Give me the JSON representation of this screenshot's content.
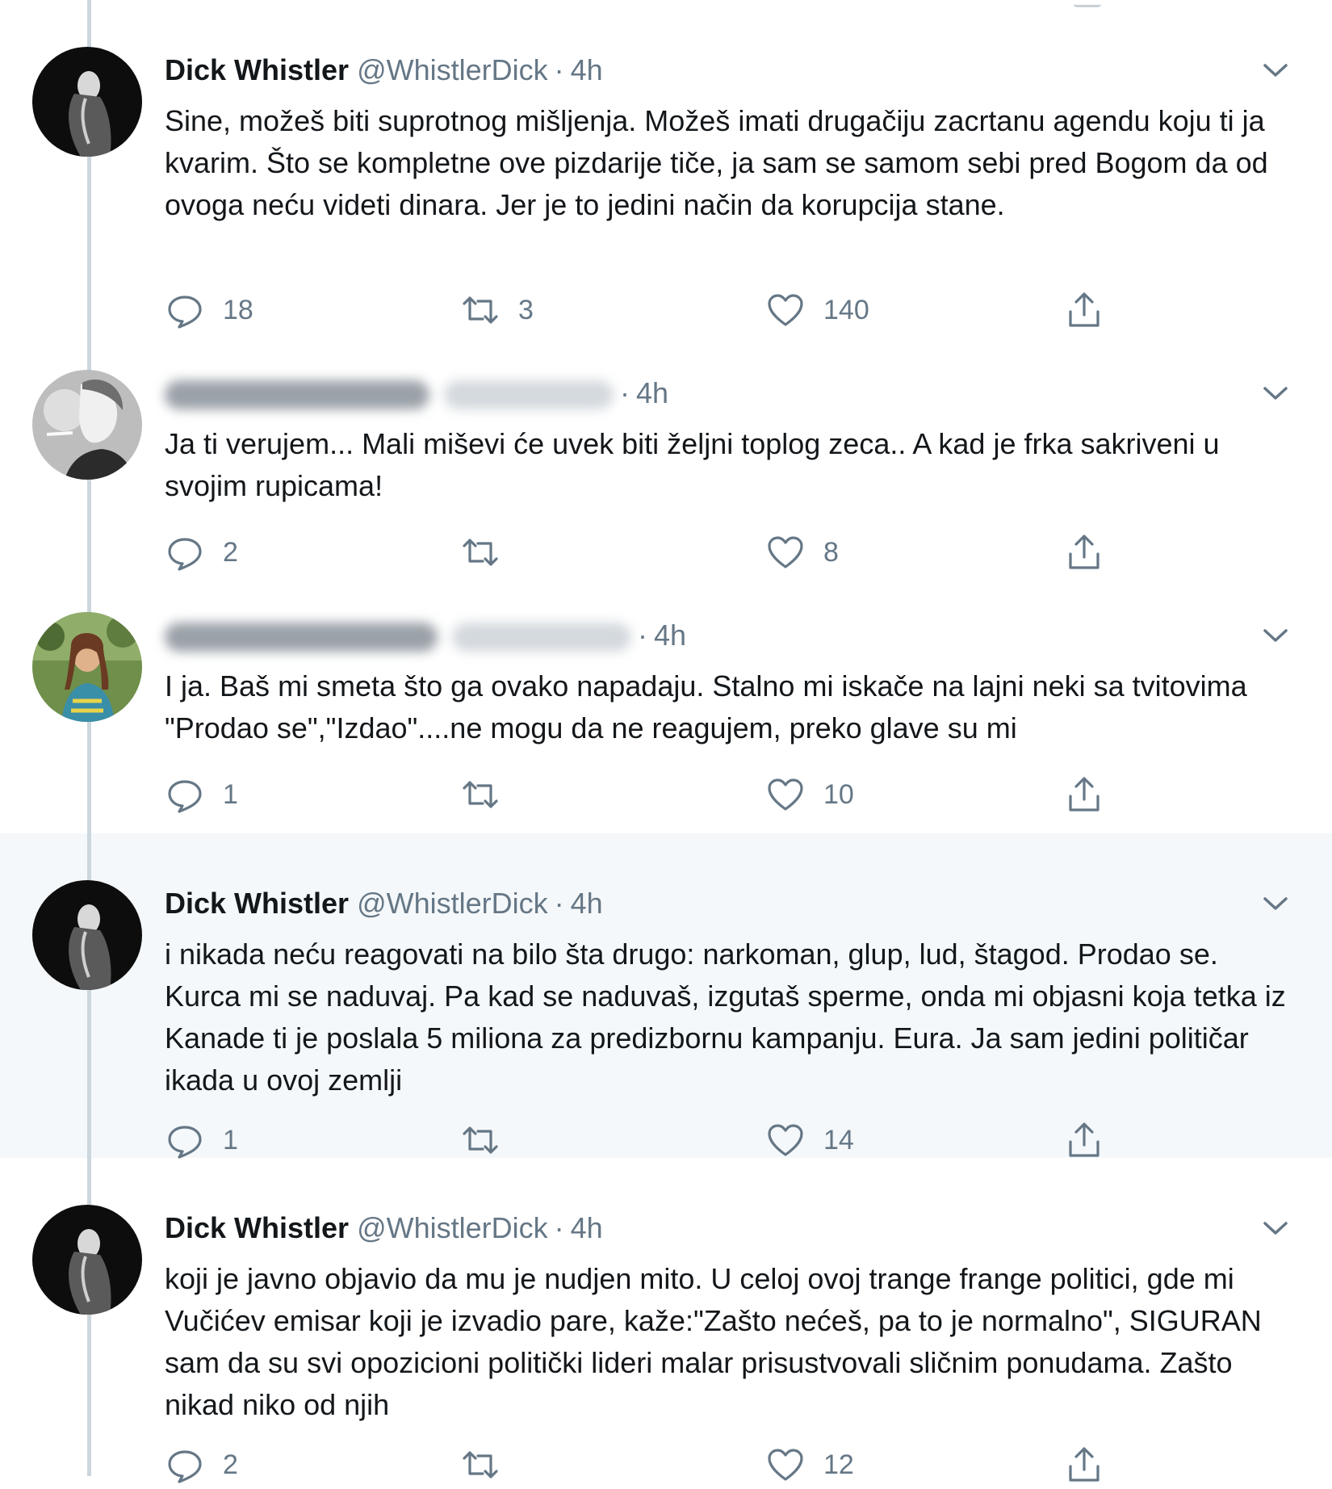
{
  "tweets": [
    {
      "avatar": "dark-portrait-avatar",
      "name": "Dick Whistler",
      "handle": "@WhistlerDick",
      "separator": "·",
      "time": "4h",
      "text": "Sine, možeš biti suprotnog mišljenja. Možeš imati drugačiju zacrtanu agendu koju ti ja kvarim. Što se kompletne ove pizdarije tiče, ja sam se samom sebi pred Bogom da od ovoga neću videti dinara. Jer je to jedini način da korupcija stane.",
      "replies": "18",
      "retweets": "3",
      "likes": "140"
    },
    {
      "avatar": "smoking-portrait-avatar",
      "name_blurred": true,
      "separator": "·",
      "time": "4h",
      "text": "Ja ti verujem... Mali miševi će uvek biti željni toplog zeca.. A kad je frka sakriveni u svojim rupicama!",
      "replies": "2",
      "retweets": "",
      "likes": "8"
    },
    {
      "avatar": "woman-photo-avatar",
      "name_blurred": true,
      "separator": "·",
      "time": "4h",
      "text": "I ja. Baš mi smeta što ga ovako napadaju. Stalno mi iskače na lajni neki sa tvitovima \"Prodao se\",\"Izdao\"....ne mogu da ne reagujem, preko glave su mi",
      "replies": "1",
      "retweets": "",
      "likes": "10"
    },
    {
      "avatar": "dark-portrait-avatar",
      "name": "Dick Whistler",
      "handle": "@WhistlerDick",
      "separator": "·",
      "time": "4h",
      "text": "i nikada neću reagovati na bilo šta drugo: narkoman, glup, lud, štagod. Prodao se. Kurca mi se naduvaj. Pa kad se naduvaš, izgutaš sperme, onda mi objasni koja tetka iz Kanade ti je poslala 5 miliona za predizbornu kampanju. Eura. Ja sam jedini političar ikada u ovoj zemlji",
      "replies": "1",
      "retweets": "",
      "likes": "14"
    },
    {
      "avatar": "dark-portrait-avatar",
      "name": "Dick Whistler",
      "handle": "@WhistlerDick",
      "separator": "·",
      "time": "4h",
      "text": "koji je javno objavio da mu je nudjen mito. U celoj ovoj trange frange politici, gde mi Vučićev emisar koji je izvadio pare, kaže:\"Zašto nećeš, pa to je normalno\", SIGURAN sam da su svi opozicioni politički lideri malar prisustvovali sličnim ponudama. Zašto nikad niko od njih",
      "replies": "2",
      "retweets": "",
      "likes": "12"
    }
  ],
  "colors": {
    "text": "#14171a",
    "secondary": "#657786",
    "thread_line": "#ccd6dd",
    "highlight_bg": "#f5f8fa"
  }
}
